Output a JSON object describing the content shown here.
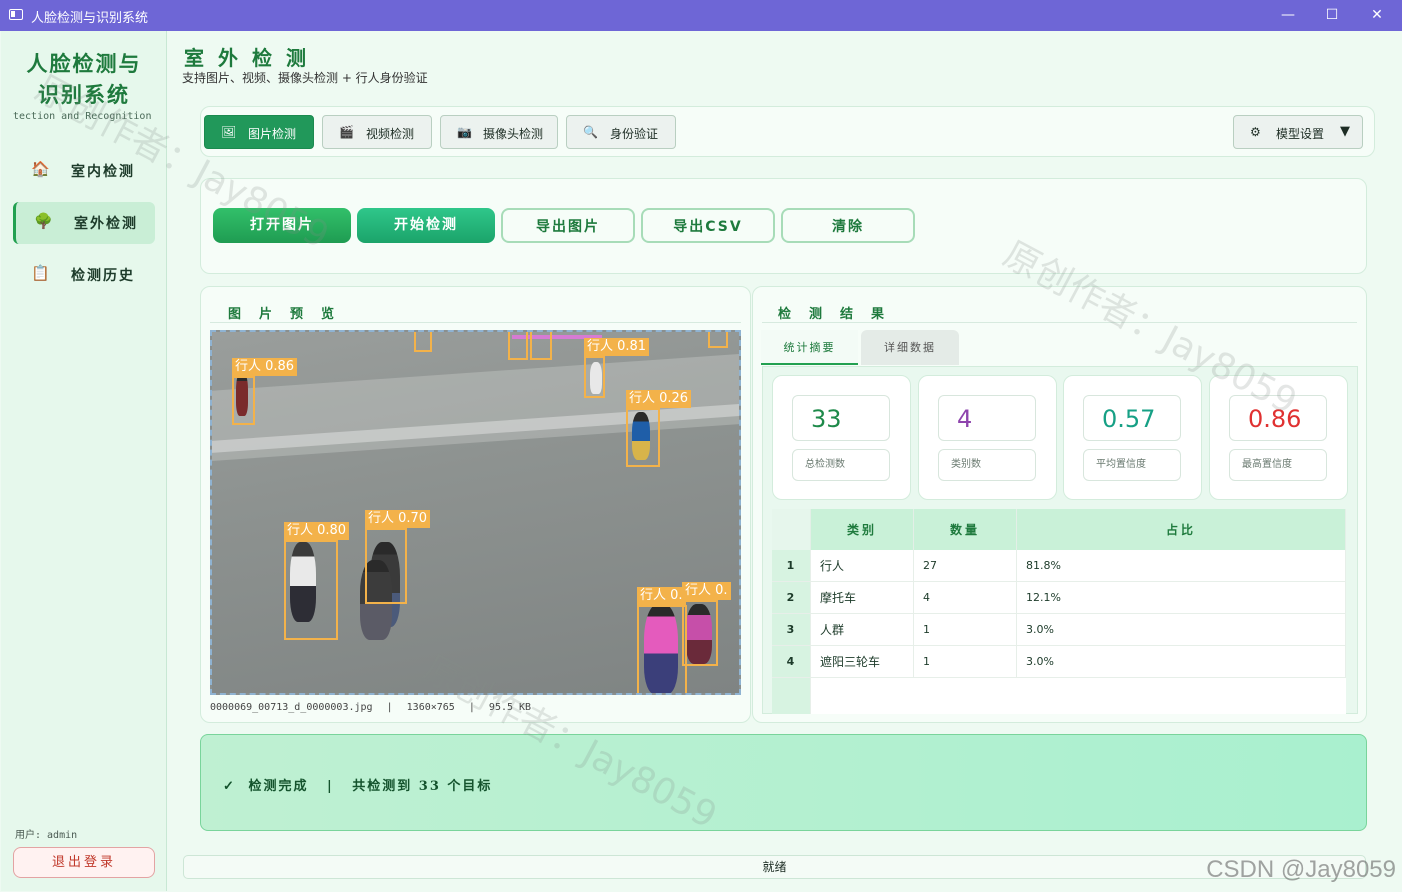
{
  "window": {
    "title": "人脸检测与识别系统",
    "min": "—",
    "max": "☐",
    "close": "✕"
  },
  "sidebar": {
    "brand_line1": "人脸检测与",
    "brand_line2": "识别系统",
    "brand_en": "tection and Recognition",
    "items": [
      {
        "icon": "🏠",
        "label": "室内检测"
      },
      {
        "icon": "🌳",
        "label": "室外检测"
      },
      {
        "icon": "📋",
        "label": "检测历史"
      }
    ],
    "user": "用户: admin",
    "logout": "退出登录"
  },
  "header": {
    "title": "室外检测",
    "subtitle": "支持图片、视频、摄像头检测 + 行人身份验证"
  },
  "tabs": [
    {
      "icon": "🖼",
      "label": "图片检测"
    },
    {
      "icon": "🎬",
      "label": "视频检测"
    },
    {
      "icon": "📷",
      "label": "摄像头检测"
    },
    {
      "icon": "🔍",
      "label": "身份验证"
    }
  ],
  "model_settings": {
    "icon": "⚙",
    "label": "模型设置",
    "arrow": "▼"
  },
  "actions": {
    "open": "打开图片",
    "start": "开始检测",
    "export_img": "导出图片",
    "export_csv": "导出CSV",
    "clear": "清除"
  },
  "preview": {
    "title": "图片预览",
    "filename": "0000069_00713_d_0000003.jpg",
    "sep": "|",
    "resolution": "1360×765",
    "filesize": "95.5 KB",
    "detections": [
      {
        "label": "行人 0.86"
      },
      {
        "label": "行人 0.81"
      },
      {
        "label": "行人 0.26"
      },
      {
        "label": "行人 0.80"
      },
      {
        "label": "行人 0.70"
      },
      {
        "label": "行人 0."
      },
      {
        "label": "行人 0."
      }
    ]
  },
  "results": {
    "title": "检测结果",
    "tab_summary": "统计摘要",
    "tab_detail": "详细数据",
    "stats": [
      {
        "value": "33",
        "caption": "总检测数",
        "color": "#1e8a4a"
      },
      {
        "value": "4",
        "caption": "类别数",
        "color": "#8e44ad"
      },
      {
        "value": "0.57",
        "caption": "平均置信度",
        "color": "#16a085"
      },
      {
        "value": "0.86",
        "caption": "最高置信度",
        "color": "#e03131"
      }
    ],
    "table": {
      "columns": [
        "类别",
        "数量",
        "占比"
      ],
      "rows": [
        {
          "idx": "1",
          "cls": "行人",
          "count": "27",
          "pct": "81.8%"
        },
        {
          "idx": "2",
          "cls": "摩托车",
          "count": "4",
          "pct": "12.1%"
        },
        {
          "idx": "3",
          "cls": "人群",
          "count": "1",
          "pct": "3.0%"
        },
        {
          "idx": "4",
          "cls": "遮阳三轮车",
          "count": "1",
          "pct": "3.0%"
        }
      ]
    }
  },
  "status": {
    "check": "✓",
    "done": "检测完成",
    "sep": "|",
    "summary": "共检测到 33 个目标"
  },
  "progress": {
    "text": "就绪"
  },
  "watermark": {
    "text1": "原创作者：Jay8059",
    "csdn": "CSDN @Jay8059"
  }
}
